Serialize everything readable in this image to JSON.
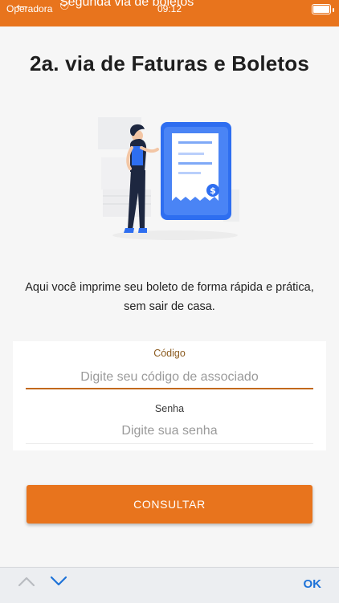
{
  "status_bar": {
    "carrier": "Operadora",
    "time": "09:12"
  },
  "nav": {
    "title": "Segunda via de boletos"
  },
  "page": {
    "title": "2a. via de Faturas e Boletos",
    "description": "Aqui você imprime seu boleto de forma rápida e prática, sem sair de casa."
  },
  "form": {
    "code_label": "Código",
    "code_placeholder": "Digite seu código de associado",
    "password_label": "Senha",
    "password_placeholder": "Digite sua senha",
    "submit_label": "CONSULTAR"
  },
  "keyboard_toolbar": {
    "done_label": "OK"
  },
  "colors": {
    "brand": "#e8741d",
    "accent_blue": "#2e6ef0",
    "link_blue": "#1d72d8"
  }
}
